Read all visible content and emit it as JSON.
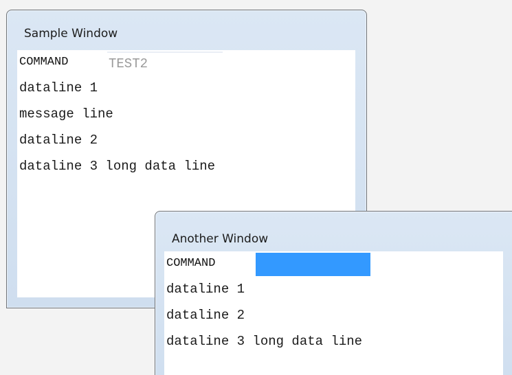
{
  "sample_window": {
    "title": "Sample Window",
    "command_label": "COMMAND",
    "command_value": "TEST2",
    "lines": [
      "dataline 1",
      "message line",
      "dataline 2",
      "dataline 3 long data line"
    ]
  },
  "another_window": {
    "title": "Another Window",
    "command_label": "COMMAND",
    "command_value": "",
    "lines": [
      "dataline 1",
      "dataline 2",
      "dataline 3 long data line"
    ]
  },
  "colors": {
    "window_frame": "#cfdeef",
    "selection": "#3399ff",
    "placeholder_text": "#9a9a9a"
  }
}
